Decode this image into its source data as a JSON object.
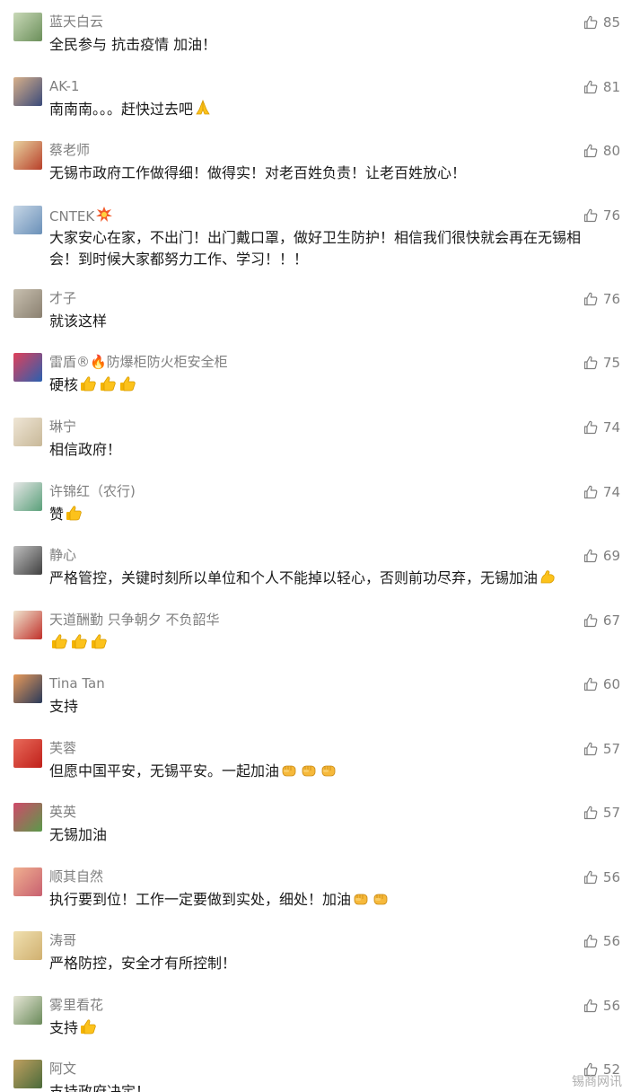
{
  "comments": [
    {
      "name": "蓝天白云",
      "text": "全民参与 抗击疫情 加油！",
      "likes": "85",
      "avatar": [
        "#6b8f5a",
        "#c9d9b8"
      ],
      "emojis": []
    },
    {
      "name": "AK-1",
      "text": "南南南。。。赶快过去吧",
      "likes": "81",
      "avatar": [
        "#3a4a7a",
        "#d8b08a"
      ],
      "emojis": [
        "pray"
      ]
    },
    {
      "name": "蔡老师",
      "text": "无锡市政府工作做得细！做得实！对老百姓负责！让老百姓放心！",
      "likes": "80",
      "avatar": [
        "#b8402a",
        "#e8d3a0"
      ],
      "emojis": []
    },
    {
      "name": "CNTEK",
      "text": "大家安心在家，不出门！出门戴口罩，做好卫生防护！相信我们很快就会再在无锡相会！到时候大家都努力工作、学习！！！",
      "likes": "76",
      "avatar": [
        "#6a90b8",
        "#c6d6e6"
      ],
      "emojis": [],
      "name_emoji": "boom"
    },
    {
      "name": "才子",
      "text": "就该这样",
      "likes": "76",
      "avatar": [
        "#8a8070",
        "#c8c0b0"
      ],
      "emojis": []
    },
    {
      "name": "雷盾®🔥防爆柜防火柜安全柜",
      "text": "硬核",
      "likes": "75",
      "avatar": [
        "#2a60b0",
        "#e0405a"
      ],
      "emojis": [
        "thumb",
        "thumb",
        "thumb"
      ]
    },
    {
      "name": "琳宁",
      "text": "相信政府！",
      "likes": "74",
      "avatar": [
        "#c8b898",
        "#efe6d6"
      ],
      "emojis": []
    },
    {
      "name": "许锦红（农行)",
      "text": "赞",
      "likes": "74",
      "avatar": [
        "#5aa07a",
        "#e6e6e6"
      ],
      "emojis": [
        "thumb"
      ]
    },
    {
      "name": "静心",
      "text": "严格管控，关键时刻所以单位和个人不能掉以轻心，否则前功尽弃，无锡加油",
      "likes": "69",
      "avatar": [
        "#404040",
        "#bfbfbf"
      ],
      "emojis": [
        "muscle"
      ]
    },
    {
      "name": "天道酬勤 只争朝夕 不负韶华",
      "text": "",
      "likes": "67",
      "avatar": [
        "#c0302a",
        "#f0e6d0"
      ],
      "emojis": [
        "thumb",
        "thumb",
        "thumb"
      ]
    },
    {
      "name": "Tina Tan",
      "text": "支持",
      "likes": "60",
      "avatar": [
        "#2a3a5a",
        "#e89a5a"
      ],
      "emojis": []
    },
    {
      "name": "芙蓉",
      "text": "但愿中国平安，无锡平安。一起加油",
      "likes": "57",
      "avatar": [
        "#c0201a",
        "#e86a5a"
      ],
      "emojis": [
        "fist",
        "fist",
        "fist"
      ]
    },
    {
      "name": "英英",
      "text": "无锡加油",
      "likes": "57",
      "avatar": [
        "#5a9a4a",
        "#d04a6a"
      ],
      "emojis": []
    },
    {
      "name": "顺其自然",
      "text": "执行要到位！工作一定要做到实处，细处！加油",
      "likes": "56",
      "avatar": [
        "#c86070",
        "#f0b090"
      ],
      "emojis": [
        "fist",
        "fist"
      ]
    },
    {
      "name": "涛哥",
      "text": "严格防控，安全才有所控制！",
      "likes": "56",
      "avatar": [
        "#d0b070",
        "#f0e0b0"
      ],
      "emojis": []
    },
    {
      "name": "雾里看花",
      "text": "支持",
      "likes": "56",
      "avatar": [
        "#6a8a5a",
        "#e6e6d6"
      ],
      "emojis": [
        "thumb"
      ]
    },
    {
      "name": "阿文",
      "text": "支持政府决定！",
      "likes": "52",
      "avatar": [
        "#4a6a3a",
        "#c0a060"
      ],
      "emojis": []
    }
  ],
  "watermark": "锡商网讯",
  "colors": {
    "nickname": "#7f7f7f",
    "content": "#1a1a1a",
    "like": "#7f7f7f",
    "background": "#ffffff"
  }
}
